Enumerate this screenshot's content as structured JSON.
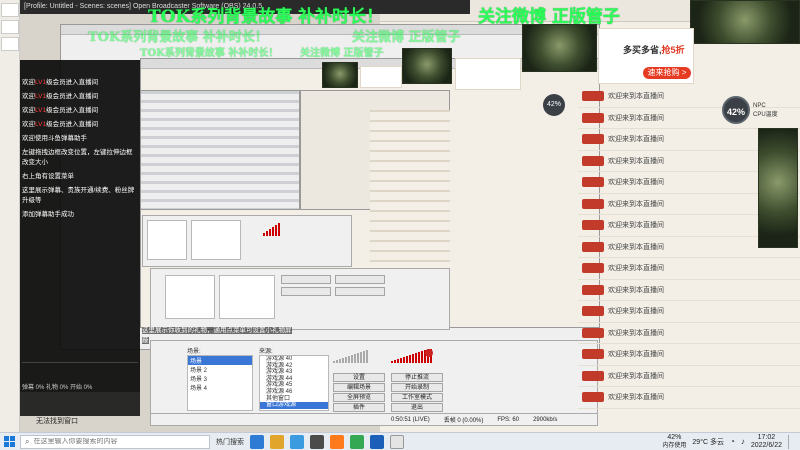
{
  "title_strip": "[Profile: Untitled - Scenes: scenes]  Open Broadcaster Software (OBS) 24.0.5",
  "overlay": {
    "banner_part1": "TOK系列背景故事  补补时长！",
    "banner_part2": "关注微博  正版管子"
  },
  "chat": {
    "lines": [
      {
        "prefix": "欢迎",
        "level": "LV1",
        "suffix": "级会员进入直播间"
      },
      {
        "prefix": "欢迎",
        "level": "LV1",
        "suffix": "级会员进入直播间"
      },
      {
        "prefix": "欢迎",
        "level": "LV1",
        "suffix": "级会员进入直播间"
      },
      {
        "prefix": "欢迎",
        "level": "LV1",
        "suffix": "级会员进入直播间"
      },
      {
        "prefix": "",
        "level": "",
        "suffix": "欢迎使用斗鱼弹幕助手"
      },
      {
        "prefix": "",
        "level": "",
        "suffix": "左键拖拽边框改变位置，左键拉伸边框改变大小"
      },
      {
        "prefix": "",
        "level": "",
        "suffix": "右上角有设置菜单"
      },
      {
        "prefix": "",
        "level": "",
        "suffix": "这里展示弹幕、贵族开通/续费、粉丝牌升级等"
      },
      {
        "prefix": "",
        "level": "",
        "suffix": "添加弹幕助手成功"
      }
    ],
    "gift_hint": "这里展示你收到的礼物，通用点菜单可设置小礼物屏蔽",
    "footer": "弹幕 0%  礼物 0%  开始  0%"
  },
  "ads": [
    {
      "text_before": "多买多省,",
      "highlight": "抢5折",
      "button": "速来抢购 >"
    }
  ],
  "perf": {
    "percent": "42%",
    "label1": "NPC",
    "label2": "CPU温度"
  },
  "web_list": {
    "rows": [
      "欢迎来到本直播间",
      "欢迎来到本直播间",
      "欢迎来到本直播间",
      "欢迎来到本直播间",
      "欢迎来到本直播间",
      "欢迎来到本直播间",
      "欢迎来到本直播间",
      "欢迎来到本直播间",
      "欢迎来到本直播间",
      "欢迎来到本直播间",
      "欢迎来到本直播间",
      "欢迎来到本直播间",
      "欢迎来到本直播间",
      "欢迎来到本直播间",
      "欢迎来到本直播间"
    ]
  },
  "obs_dialog": {
    "scenes_label": "场景:",
    "scenes": [
      "场景",
      "场景 2",
      "场景 3",
      "场景 4"
    ],
    "sources_label": "来源:",
    "sources": [
      "游戏源 40",
      "游戏源 42",
      "游戏源 43",
      "游戏源 44",
      "游戏源 45",
      "游戏源 46",
      "其他窗口",
      "窗口游戏源"
    ],
    "buttons": {
      "settings": "设置",
      "stop_stream": "停止推流",
      "edit_scene": "编辑场景",
      "start_record": "开始录制",
      "fullscreen_preview": "全屏预览",
      "studio_mode": "工作室模式",
      "plugins": "插件",
      "exit": "退出"
    },
    "status_time": "0:50:51 (LIVE)",
    "status_dropped": "丢帧 0 (0.00%)",
    "status_fps": "FPS: 60",
    "status_bitrate": "2900kb/s",
    "bottom_label": "无法找到窗口"
  },
  "taskbar": {
    "search_placeholder": "在这里输入你要搜索的内容",
    "hot_search": "热门搜索",
    "cpu_percent": "42%",
    "cpu_label": "内存使用",
    "weather": "29°C 多云",
    "time": "17:02",
    "date": "2022/6/22",
    "colors": {
      "accent": "#1a78d8",
      "green_text": "#2dff5a",
      "ad_red": "#e63b22"
    }
  }
}
